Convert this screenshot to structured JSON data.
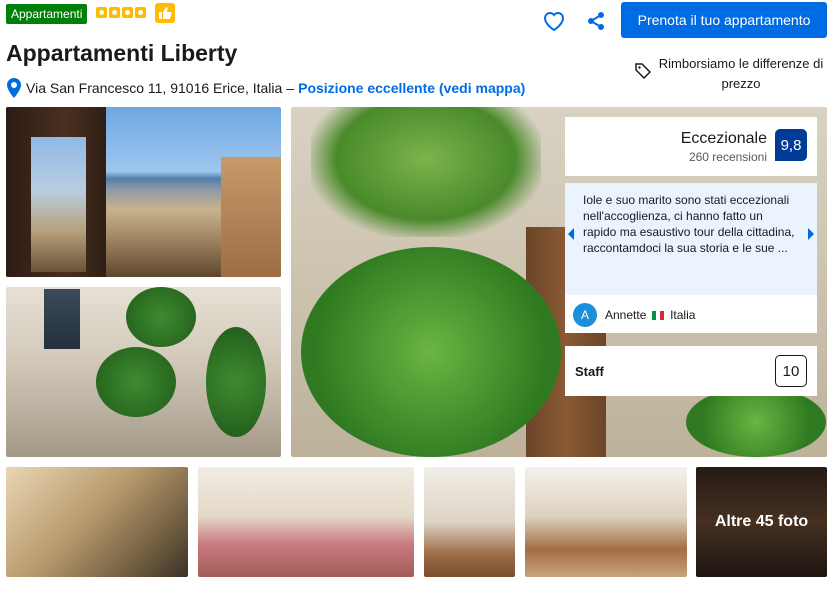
{
  "header": {
    "property_type": "Appartamenti",
    "star_count": 4,
    "title": "Appartamenti Liberty",
    "address": "Via San Francesco 11, 91016 Erice, Italia",
    "separator": "–",
    "map_link": "Posizione eccellente (vedi mappa)"
  },
  "actions": {
    "book_label": "Prenota il tuo appartamento",
    "heart_icon": "heart-icon",
    "share_icon": "share-icon",
    "refund_text": "Rimborsiamo le differenze di prezzo"
  },
  "rating": {
    "label": "Eccezionale",
    "reviews": "260 recensioni",
    "score": "9,8"
  },
  "review": {
    "text": "Iole e suo marito sono stati eccezionali nell'accoglienza, ci hanno fatto un rapido ma esaustivo tour della cittadina, raccontamdoci la sua storia e le sue ...",
    "avatar_letter": "A",
    "author": "Annette",
    "country": "Italia"
  },
  "staff": {
    "label": "Staff",
    "score": "10"
  },
  "gallery": {
    "more_photos": "Altre 45 foto"
  },
  "colors": {
    "primary_blue": "#006ce4",
    "score_blue": "#003b95",
    "badge_green": "#008009",
    "star_yellow": "#febb02"
  }
}
